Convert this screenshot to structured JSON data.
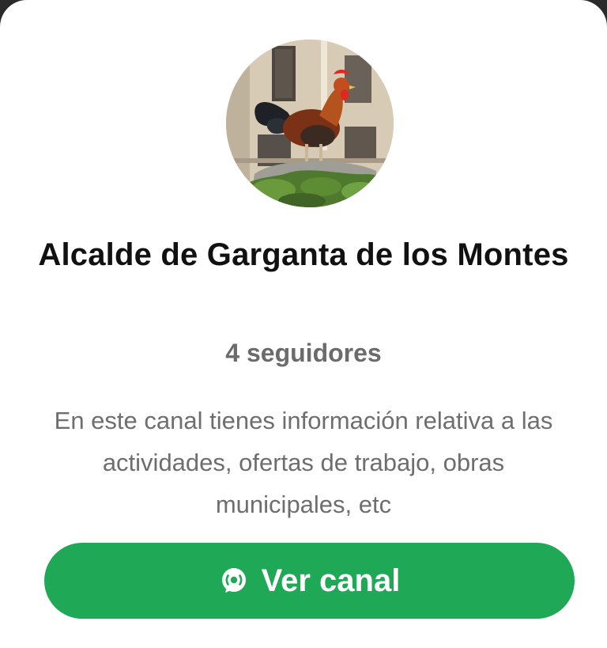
{
  "channel": {
    "avatar_icon": "rooster-photo",
    "name": "Alcalde de Garganta de los Montes",
    "followers": "4 seguidores",
    "description": "En este canal tienes información relativa a las actividades, ofertas de trabajo, obras municipales, etc"
  },
  "action": {
    "label": "Ver canal",
    "icon": "channel-icon"
  },
  "colors": {
    "accent": "#1fa855",
    "title": "#111111",
    "secondary_text": "#6b6b6b"
  }
}
